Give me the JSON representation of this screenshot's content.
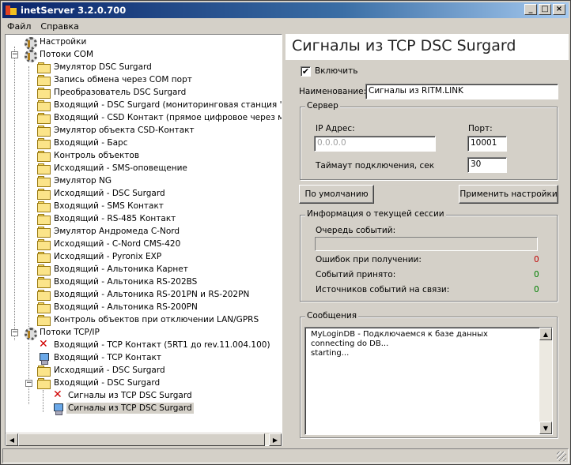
{
  "window": {
    "title": "inetServer 3.2.0.700",
    "minimize": "_",
    "maximize": "□",
    "close": "×"
  },
  "menu": {
    "file": "Файл",
    "help": "Справка"
  },
  "tree": {
    "settings": "Настройки",
    "com_group": "Потоки COM",
    "com_items": [
      "Эмулятор DSC Surgard",
      "Запись обмена через COM порт",
      "Преобразователь DSC Surgard",
      "Входящий - DSC Surgard (мониторинговая станция \"Конт",
      "Входящий - CSD Контакт (прямое цифровое через модем",
      "Эмулятор объекта CSD-Контакт",
      "Входящий - Барс",
      "Контроль объектов",
      "Исходящий - SMS-оповещение",
      "Эмулятор NG",
      "Исходящий - DSC Surgard",
      "Входящий - SMS Контакт",
      "Входящий - RS-485 Контакт",
      "Эмулятор Андромеда C-Nord",
      "Исходящий - C-Nord CMS-420",
      "Исходящий - Pyronix EXP",
      "Входящий - Альтоника Карнет",
      "Входящий - Альтоника RS-202BS",
      "Входящий - Альтоника RS-201PN и RS-202PN",
      "Входящий - Альтоника RS-200PN",
      "Контроль объектов при отключении LAN/GPRS"
    ],
    "tcp_group": "Потоки TCP/IP",
    "tcp_items": [
      "Входящий - TCP Контакт (5RT1 до rev.11.004.100)",
      "Входящий - TCP Контакт",
      "Исходящий - DSC Surgard",
      "Входящий - DSC Surgard"
    ],
    "dsc_children": [
      "Сигналы из TCP DSC Surgard",
      "Сигналы из TCP DSC Surgard"
    ]
  },
  "panel": {
    "title": "Сигналы из TCP DSC Surgard",
    "enable_label": "Включить",
    "enable_mark": "✔",
    "name_label": "Наименование:",
    "name_value": "Сигналы из RITM.LINK",
    "server_group": "Сервер",
    "ip_label": "IP Адрес:",
    "ip_value": "0.0.0.0",
    "port_label": "Порт:",
    "port_value": "10001",
    "timeout_label": "Таймаут подключения, сек",
    "timeout_value": "30",
    "default_button": "По умолчанию",
    "apply_button": "Применить настройки",
    "session_group": "Информация о текущей сессии",
    "queue_label": "Очередь событий:",
    "queue_fill": 0,
    "errors_label": "Ошибок при получении:",
    "errors_value": "0",
    "received_label": "Событий принято:",
    "received_value": "0",
    "sources_label": "Источников событий на связи:",
    "sources_value": "0",
    "messages_group": "Сообщения",
    "messages": [
      "MyLoginDB - Подключаемся к базе данных",
      "connecting do DB...",
      "starting..."
    ]
  }
}
